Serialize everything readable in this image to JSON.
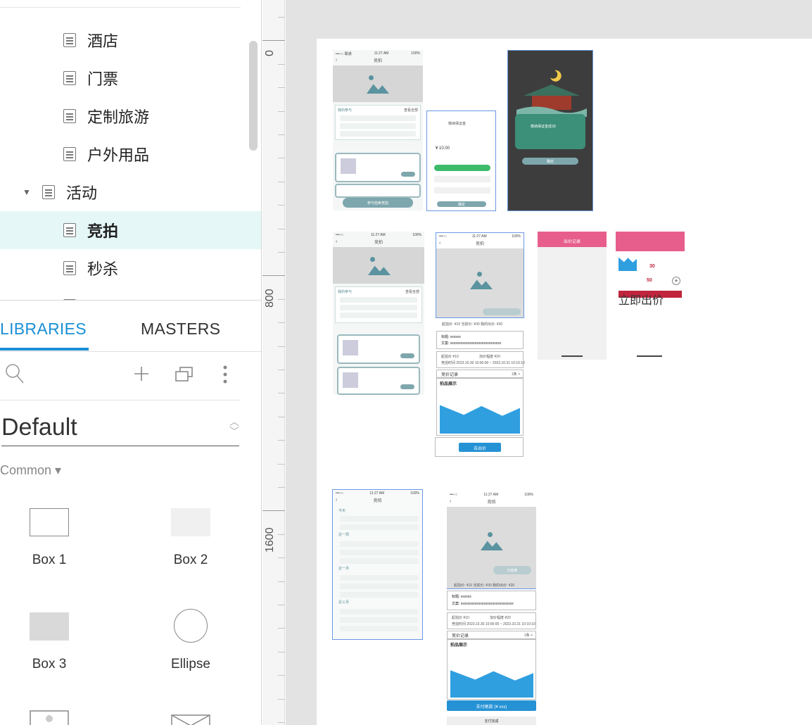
{
  "page_tree": {
    "items": [
      {
        "label": "酒店"
      },
      {
        "label": "门票"
      },
      {
        "label": "定制旅游"
      },
      {
        "label": "户外用品"
      },
      {
        "label": "活动"
      },
      {
        "label": "竞拍"
      },
      {
        "label": "秒杀"
      }
    ]
  },
  "panel_tabs": {
    "libraries": "LIBRARIES",
    "masters": "MASTERS"
  },
  "library": {
    "selected": "Default",
    "category": "Common ▾",
    "widgets": [
      {
        "label": "Box 1"
      },
      {
        "label": "Box 2"
      },
      {
        "label": "Box 3"
      },
      {
        "label": "Ellipse"
      }
    ]
  },
  "ruler": {
    "labels": [
      "0",
      "800",
      "1600"
    ]
  },
  "colors": {
    "accent": "#1a8fd6",
    "selected_row": "#e6f7f7",
    "canvas_bg": "#e3e3e3",
    "teal": "#7ea7ad",
    "pink": "#e75e8c"
  },
  "screens": {
    "s1": {
      "status_left": "•••○○ 联通",
      "time": "11:27 AM",
      "battery": "100%",
      "title": "竞拍",
      "section": "我的参与",
      "hint": "查看全部",
      "button": "参与拍卖竞拍"
    },
    "s2": {
      "title": "缴纳保证金",
      "amount": "¥ 10.00",
      "button": "确定"
    },
    "s3": {
      "message": "缴纳保证金成功!",
      "button": "确定"
    },
    "s4": {
      "time": "11:27 AM",
      "battery": "100%",
      "title": "竞拍",
      "section": "我的参与",
      "hint": "查看全部"
    },
    "s5": {
      "time": "11:27 AM",
      "battery": "100%",
      "title": "竞拍",
      "stats": "起拍价: ¥10   当前价: ¥30   我的出价: ¥20",
      "subject": "标题: xxxxxx",
      "content": "文案: xxxxxxxxxxxxxxxxxxxxxxxxxxxxx",
      "start_price": "起拍价 ¥10",
      "increment": "加价幅度 ¥20",
      "period": "竞拍时间 2023.10.30 10:00:00 ~ 2023.10.31 10:10:10",
      "records": "竞价记录",
      "record_count": "1条 >",
      "gallery": "拍品展示",
      "button": "去出价"
    },
    "s6": {
      "title": "出价记录"
    },
    "s7": {
      "price1": "30",
      "price2": "50",
      "button": "立即出价"
    },
    "s8": {
      "time": "11:27 AM",
      "title": "竞拍",
      "today": "今天",
      "recent1": "近一周",
      "recent2": "近一月",
      "recent3": "近三月"
    },
    "s9": {
      "time": "11:27 AM",
      "battery": "100%",
      "title": "竞拍",
      "ended": "已结束",
      "stats": "起拍价: ¥10   当前价: ¥30   我的出价: ¥20",
      "subject": "标题: xxxxxx",
      "content": "文案: xxxxxxxxxxxxxxxxxxxxxxxxxxxxxx",
      "start_price": "起拍价 ¥10",
      "increment": "加价幅度 ¥20",
      "period": "竞拍时间 2023.10.30 10:00:00 ~ 2023.10.31 10:10:10",
      "records": "竞价记录",
      "record_count": "1条 >",
      "gallery": "拍品展示",
      "pay_button": "支付尾款 (¥ xxx)",
      "done_button": "支付完成"
    }
  }
}
